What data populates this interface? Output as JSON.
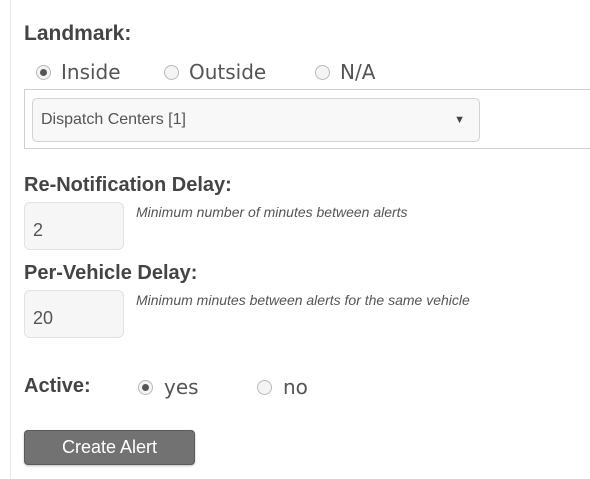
{
  "landmark": {
    "label": "Landmark:",
    "options": [
      {
        "label": "Inside",
        "checked": true
      },
      {
        "label": "Outside",
        "checked": false
      },
      {
        "label": "N/A",
        "checked": false
      }
    ],
    "select": {
      "value": "Dispatch Centers [1]"
    }
  },
  "renotification": {
    "label": "Re-Notification Delay:",
    "value": "2",
    "hint": "Minimum number of minutes between alerts"
  },
  "per_vehicle": {
    "label": "Per-Vehicle Delay:",
    "value": "20",
    "hint": "Minimum minutes between alerts for the same vehicle"
  },
  "active": {
    "label": "Active:",
    "options": [
      {
        "label": "yes",
        "checked": true
      },
      {
        "label": "no",
        "checked": false
      }
    ]
  },
  "create_button": {
    "label": "Create Alert"
  },
  "colors": {
    "button_bg": "#727272",
    "text": "#444444"
  }
}
